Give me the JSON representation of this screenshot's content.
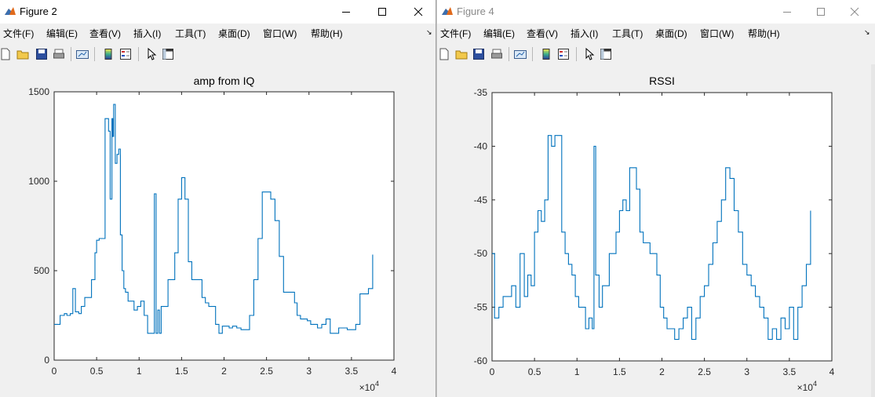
{
  "windows": [
    {
      "id": "win2",
      "title": "Figure 2",
      "menu": [
        "文件(F)",
        "编辑(E)",
        "查看(V)",
        "插入(I)",
        "工具(T)",
        "桌面(D)",
        "窗口(W)",
        "帮助(H)"
      ]
    },
    {
      "id": "win4",
      "title": "Figure 4",
      "menu": [
        "文件(F)",
        "编辑(E)",
        "查看(V)",
        "插入(I)",
        "工具(T)",
        "桌面(D)",
        "窗口(W)",
        "帮助(H)"
      ]
    }
  ],
  "toolbar_icons": [
    "new-figure-icon",
    "open-file-icon",
    "save-icon",
    "print-icon",
    "link-plot-icon",
    "colorbar-icon",
    "legend-icon",
    "pointer-icon",
    "property-inspector-icon"
  ],
  "colors": {
    "line": "#0072BD",
    "axes_bg": "#ffffff",
    "figure_bg": "#f0f0f0"
  },
  "chart_data": [
    {
      "type": "line",
      "title": "amp from IQ",
      "xlabel": "",
      "ylabel": "",
      "xlim": [
        0,
        40000
      ],
      "ylim": [
        0,
        1500
      ],
      "xtick_labels": [
        "0",
        "0.5",
        "1",
        "1.5",
        "2",
        "2.5",
        "3",
        "3.5",
        "4"
      ],
      "ytick_labels": [
        "0",
        "500",
        "1000",
        "1500"
      ],
      "x_exponent": "×10",
      "x_exponent_power": "4",
      "series": [
        {
          "x": [
            0,
            300,
            700,
            900,
            1200,
            1500,
            1900,
            2200,
            2500,
            2900,
            3200,
            3600,
            4000,
            4400,
            4800,
            5000,
            5300,
            5700,
            6000,
            6200,
            6400,
            6600,
            6800,
            6900,
            7000,
            7100,
            7200,
            7400,
            7600,
            7800,
            8000,
            8200,
            8400,
            8700,
            9000,
            9400,
            9800,
            10200,
            10600,
            11000,
            11400,
            11800,
            12000,
            12200,
            12400,
            12600,
            13000,
            13400,
            13800,
            14200,
            14600,
            15000,
            15400,
            15800,
            16200,
            16600,
            17000,
            17400,
            17800,
            18200,
            18600,
            19000,
            19400,
            19800,
            20200,
            20600,
            21000,
            21500,
            22000,
            22500,
            23000,
            23500,
            24000,
            24500,
            25000,
            25500,
            26000,
            26500,
            27000,
            27500,
            28000,
            28300,
            28600,
            29000,
            29400,
            29800,
            30200,
            30600,
            31000,
            31500,
            32000,
            32500,
            33000,
            33500,
            34000,
            34500,
            35000,
            35500,
            36000,
            36500,
            37000,
            37500
          ],
          "y": [
            200,
            200,
            250,
            250,
            260,
            250,
            260,
            400,
            270,
            260,
            300,
            350,
            350,
            450,
            600,
            670,
            680,
            680,
            1350,
            1350,
            1280,
            900,
            1350,
            1250,
            1430,
            1430,
            1100,
            1150,
            1180,
            700,
            500,
            400,
            380,
            330,
            330,
            280,
            300,
            330,
            250,
            150,
            150,
            930,
            150,
            280,
            150,
            300,
            300,
            450,
            450,
            600,
            900,
            1020,
            900,
            550,
            450,
            450,
            450,
            350,
            320,
            300,
            300,
            200,
            150,
            190,
            190,
            180,
            190,
            180,
            170,
            170,
            250,
            450,
            680,
            940,
            940,
            900,
            780,
            580,
            380,
            380,
            380,
            320,
            250,
            230,
            230,
            220,
            200,
            200,
            180,
            200,
            230,
            150,
            150,
            180,
            180,
            170,
            170,
            200,
            370,
            370,
            400,
            590
          ]
        }
      ]
    },
    {
      "type": "line",
      "title": "RSSI",
      "xlabel": "",
      "ylabel": "",
      "xlim": [
        0,
        40000
      ],
      "ylim": [
        -60,
        -35
      ],
      "xtick_labels": [
        "0",
        "0.5",
        "1",
        "1.5",
        "2",
        "2.5",
        "3",
        "3.5",
        "4"
      ],
      "ytick_labels": [
        "-60",
        "-55",
        "-50",
        "-45",
        "-40",
        "-35"
      ],
      "x_exponent": "×10",
      "x_exponent_power": "4",
      "series": [
        {
          "x": [
            0,
            300,
            800,
            1300,
            1800,
            2300,
            2800,
            3300,
            3800,
            4200,
            4600,
            5000,
            5400,
            5800,
            6200,
            6600,
            7000,
            7400,
            7800,
            8200,
            8600,
            9000,
            9400,
            9800,
            10200,
            10600,
            11000,
            11400,
            11800,
            12000,
            12200,
            12600,
            13000,
            13400,
            13800,
            14200,
            14600,
            15000,
            15400,
            15800,
            16200,
            16600,
            17000,
            17400,
            17800,
            18200,
            18600,
            19000,
            19400,
            19800,
            20200,
            20600,
            21000,
            21500,
            22000,
            22500,
            23000,
            23500,
            24000,
            24500,
            25000,
            25500,
            26000,
            26500,
            27000,
            27500,
            28000,
            28500,
            29000,
            29500,
            30000,
            30500,
            31000,
            31500,
            32000,
            32500,
            33000,
            33500,
            34000,
            34500,
            35000,
            35500,
            36000,
            36500,
            37000,
            37500
          ],
          "y": [
            -50,
            -56,
            -55,
            -54,
            -54,
            -53,
            -55,
            -50,
            -54,
            -52,
            -53,
            -48,
            -46,
            -47,
            -45,
            -39,
            -40,
            -39,
            -39,
            -48,
            -50,
            -51,
            -52,
            -54,
            -55,
            -55,
            -57,
            -56,
            -57,
            -40,
            -52,
            -55,
            -53,
            -53,
            -50,
            -50,
            -48,
            -46,
            -45,
            -46,
            -42,
            -42,
            -44,
            -48,
            -49,
            -49,
            -50,
            -50,
            -52,
            -55,
            -56,
            -57,
            -57,
            -58,
            -57,
            -56,
            -55,
            -58,
            -56,
            -54,
            -53,
            -51,
            -49,
            -47,
            -45,
            -42,
            -43,
            -46,
            -48,
            -51,
            -52,
            -53,
            -54,
            -55,
            -56,
            -58,
            -57,
            -58,
            -56,
            -57,
            -55,
            -58,
            -55,
            -53,
            -51,
            -46
          ]
        }
      ]
    }
  ]
}
